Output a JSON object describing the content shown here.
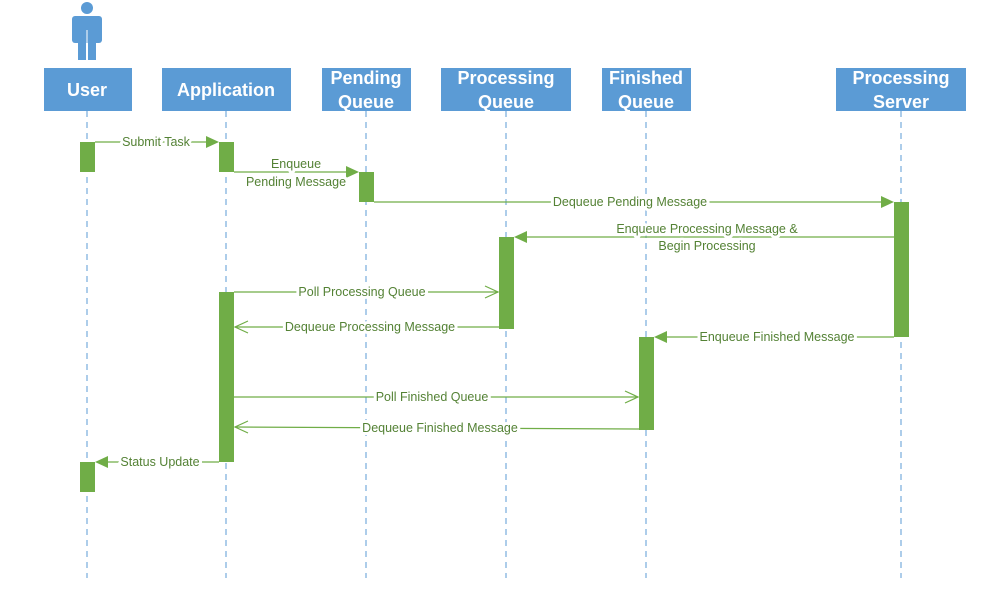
{
  "colors": {
    "participant": "#5B9BD5",
    "activation": "#70AD47",
    "message_text": "#548235"
  },
  "actor_icon": "person-icon",
  "participants": [
    {
      "line1": "User",
      "line2": ""
    },
    {
      "line1": "Application",
      "line2": ""
    },
    {
      "line1": "Pending",
      "line2": "Queue"
    },
    {
      "line1": "Processing",
      "line2": "Queue"
    },
    {
      "line1": "Finished",
      "line2": "Queue"
    },
    {
      "line1": "Processing",
      "line2": "Server"
    }
  ],
  "messages": [
    {
      "from": "User",
      "to": "Application",
      "line1": "Submit Task",
      "line2": "",
      "arrow": "filled"
    },
    {
      "from": "Application",
      "to": "Pending Queue",
      "line1": "Enqueue",
      "line2": "Pending Message",
      "arrow": "filled"
    },
    {
      "from": "Pending Queue",
      "to": "Processing Server",
      "line1": "Dequeue Pending Message",
      "line2": "",
      "arrow": "filled"
    },
    {
      "from": "Processing Server",
      "to": "Processing Queue",
      "line1": "Enqueue Processing Message &",
      "line2": "Begin Processing",
      "arrow": "filled"
    },
    {
      "from": "Application",
      "to": "Processing Queue",
      "line1": "Poll Processing Queue",
      "line2": "",
      "arrow": "open"
    },
    {
      "from": "Processing Queue",
      "to": "Application",
      "line1": "Dequeue Processing Message",
      "line2": "",
      "arrow": "open"
    },
    {
      "from": "Processing Server",
      "to": "Finished Queue",
      "line1": "Enqueue Finished Message",
      "line2": "",
      "arrow": "filled"
    },
    {
      "from": "Application",
      "to": "Finished Queue",
      "line1": "Poll Finished Queue",
      "line2": "",
      "arrow": "open"
    },
    {
      "from": "Finished Queue",
      "to": "Application",
      "line1": "Dequeue Finished Message",
      "line2": "",
      "arrow": "open"
    },
    {
      "from": "Application",
      "to": "User",
      "line1": "Status Update",
      "line2": "",
      "arrow": "filled"
    }
  ]
}
